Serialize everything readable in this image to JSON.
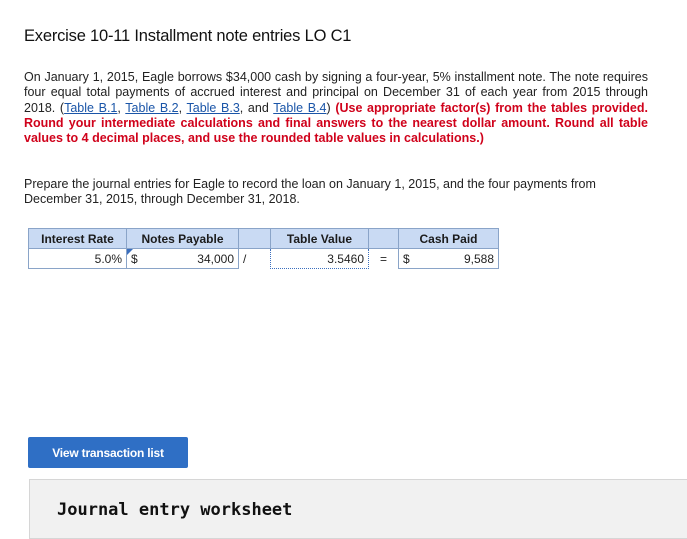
{
  "title": "Exercise 10-11 Installment note entries LO C1",
  "paragraph1": {
    "text_a": "On January 1, 2015, Eagle borrows $34,000 cash by signing a four-year, 5% installment note. The note requires four equal total payments of accrued interest and principal on December 31 of each year from 2015 through 2018. (",
    "links": [
      "Table B.1",
      "Table B.2",
      "Table B.3",
      "Table B.4"
    ],
    "sep1": ", ",
    "sep2": ", ",
    "sep3": ", and ",
    "text_b": ") ",
    "instruction": "(Use appropriate factor(s) from the tables provided. Round your intermediate calculations and final answers to the nearest dollar amount. Round all table values to 4 decimal places, and use the rounded table values in calculations.)"
  },
  "paragraph2": "Prepare the journal entries for Eagle to record the loan on January 1, 2015, and the four payments from December 31, 2015, through December 31, 2018.",
  "calc_table": {
    "headers": {
      "interest_rate": "Interest Rate",
      "notes_payable": "Notes Payable",
      "table_value": "Table Value",
      "cash_paid": "Cash Paid"
    },
    "row": {
      "interest_rate": "5.0%",
      "notes_currency": "$",
      "notes_payable": "34,000",
      "divide_op": "/",
      "table_value": "3.5460",
      "equals_op": "=",
      "cash_currency": "$",
      "cash_paid": "9,588"
    }
  },
  "button": {
    "label": "View transaction list"
  },
  "worksheet": {
    "title": "Journal entry worksheet"
  },
  "colors": {
    "link": "#1a55a8",
    "instruction_red": "#d0021b",
    "button_blue": "#2f6fc5",
    "header_blue": "#c9daf3"
  }
}
